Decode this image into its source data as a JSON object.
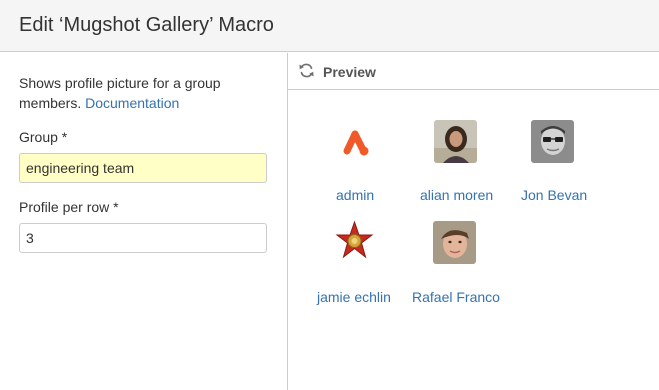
{
  "dialog": {
    "title": "Edit ‘Mugshot Gallery’ Macro"
  },
  "form": {
    "description": "Shows profile picture for a group members.",
    "doc_link": "Documentation",
    "group_label": "Group *",
    "group_value": "engineering team",
    "per_row_label": "Profile per row *",
    "per_row_value": "3"
  },
  "preview": {
    "label": "Preview",
    "icon": "refresh-icon",
    "members": [
      {
        "name": "admin",
        "avatar": "logo-avatar"
      },
      {
        "name": "alian moren",
        "avatar": "photo-avatar"
      },
      {
        "name": "Jon Bevan",
        "avatar": "photo-avatar"
      },
      {
        "name": "jamie echlin",
        "avatar": "star-badge-avatar"
      },
      {
        "name": "Rafael Franco",
        "avatar": "photo-avatar"
      }
    ]
  },
  "colors": {
    "link": "#3572b0",
    "field_highlight": "#ffffc6",
    "header_bg": "#f5f5f5",
    "brand_orange": "#f05a28"
  }
}
